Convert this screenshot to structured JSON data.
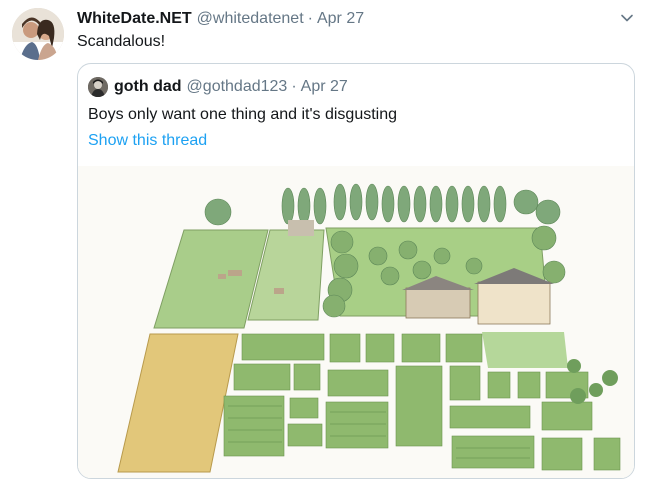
{
  "tweet": {
    "author_name": "WhiteDate.NET",
    "author_handle": "@whitedatenet",
    "separator": "·",
    "date": "Apr 27",
    "text": "Scandalous!",
    "avatar_icon": "couple-avatar-icon",
    "caret_icon": "chevron-down-icon"
  },
  "quoted": {
    "author_name": "goth dad",
    "author_handle": "@gothdad123",
    "separator": "·",
    "date": "Apr 27",
    "text": "Boys only want one thing and it's disgusting",
    "show_thread": "Show this thread",
    "avatar_icon": "goth-dad-avatar-icon",
    "media": "farm-layout-illustration"
  },
  "colors": {
    "link": "#1da1f2",
    "secondary_text": "#657786",
    "border": "#ccd6dd"
  }
}
